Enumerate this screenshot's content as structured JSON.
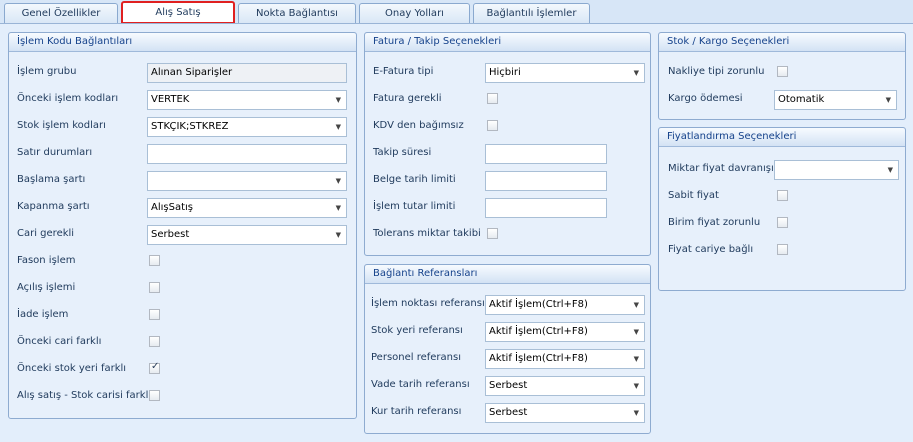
{
  "tabs": [
    {
      "label": "Genel Özellikler",
      "active": false
    },
    {
      "label": "Alış Satış",
      "active": true
    },
    {
      "label": "Nokta Bağlantısı",
      "active": false
    },
    {
      "label": "Onay Yolları",
      "active": false
    },
    {
      "label": "Bağlantılı İşlemler",
      "active": false
    }
  ],
  "islem_kodu": {
    "title": "İşlem Kodu Bağlantıları",
    "islem_grubu": {
      "label": "İşlem grubu",
      "value": "Alınan Siparişler"
    },
    "onceki_islem": {
      "label": "Önceki işlem kodları",
      "value": "VERTEK"
    },
    "stok_islem": {
      "label": "Stok işlem kodları",
      "value": "STKÇIK;STKREZ"
    },
    "satir_durumlari": {
      "label": "Satır durumları",
      "value": ""
    },
    "baslama_sarti": {
      "label": "Başlama şartı",
      "value": ""
    },
    "kapanma_sarti": {
      "label": "Kapanma şartı",
      "value": "AlışSatış"
    },
    "cari_gerekli": {
      "label": "Cari gerekli",
      "value": "Serbest"
    },
    "fason_islem": {
      "label": "Fason işlem",
      "checked": false
    },
    "acilis_islemi": {
      "label": "Açılış işlemi",
      "checked": false
    },
    "iade_islem": {
      "label": "İade işlem",
      "checked": false
    },
    "onceki_cari_farkli": {
      "label": "Önceki cari farklı",
      "checked": false
    },
    "onceki_stok_yeri_farkli": {
      "label": "Önceki stok yeri farklı",
      "checked": true
    },
    "alis_satis_stok_carisi": {
      "label": "Alış satış - Stok carisi farklı",
      "checked": false
    }
  },
  "fatura": {
    "title": "Fatura / Takip Seçenekleri",
    "efatura_tipi": {
      "label": "E-Fatura tipi",
      "value": "Hiçbiri"
    },
    "fatura_gerekli": {
      "label": "Fatura gerekli",
      "checked": false
    },
    "kdv_den_bagimsiz": {
      "label": "KDV den bağımsız",
      "checked": false
    },
    "takip_suresi": {
      "label": "Takip süresi",
      "value": ""
    },
    "belge_tarih_limiti": {
      "label": "Belge tarih limiti",
      "value": ""
    },
    "islem_tutar_limiti": {
      "label": "İşlem tutar limiti",
      "value": ""
    },
    "tolerans_miktar_takibi": {
      "label": "Tolerans miktar takibi",
      "checked": false
    }
  },
  "baglanti": {
    "title": "Bağlantı Referansları",
    "islem_noktasi": {
      "label": "İşlem noktası referansı",
      "value": "Aktif İşlem(Ctrl+F8)"
    },
    "stok_yeri": {
      "label": "Stok yeri referansı",
      "value": "Aktif İşlem(Ctrl+F8)"
    },
    "personel": {
      "label": "Personel referansı",
      "value": "Aktif İşlem(Ctrl+F8)"
    },
    "vade_tarih": {
      "label": "Vade tarih referansı",
      "value": "Serbest"
    },
    "kur_tarih": {
      "label": "Kur tarih referansı",
      "value": "Serbest"
    }
  },
  "stok_kargo": {
    "title": "Stok / Kargo Seçenekleri",
    "nakliye_tipi_zorunlu": {
      "label": "Nakliye tipi zorunlu",
      "checked": false
    },
    "kargo_odemesi": {
      "label": "Kargo ödemesi",
      "value": "Otomatik"
    }
  },
  "fiyat": {
    "title": "Fiyatlandırma Seçenekleri",
    "miktar_fiyat_davranisi": {
      "label": "Miktar fiyat davranışı",
      "value": ""
    },
    "sabit_fiyat": {
      "label": "Sabit fiyat",
      "checked": false
    },
    "birim_fiyat_zorunlu": {
      "label": "Birim fiyat zorunlu",
      "checked": false
    },
    "fiyat_cariye_bagli": {
      "label": "Fiyat cariye bağlı",
      "checked": false
    }
  },
  "icons": {
    "dropdown": "chevron-down-icon",
    "checkbox": "checkbox-icon"
  }
}
